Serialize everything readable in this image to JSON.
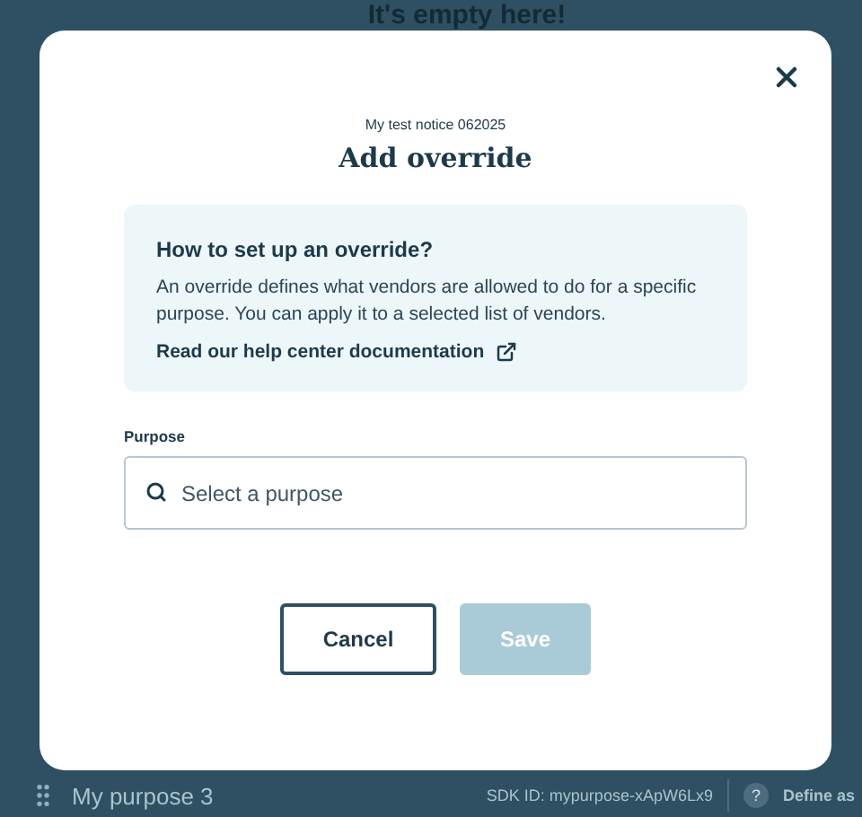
{
  "background": {
    "heading": "It's empty here!",
    "last_row": {
      "name": "My purpose 3",
      "sdk_id": "SDK ID: mypurpose-xApW6Lx9",
      "help": "?",
      "action": "Define as"
    }
  },
  "modal": {
    "subtitle": "My test notice 062025",
    "title": "Add override",
    "info": {
      "heading": "How to set up an override?",
      "text": "An override defines what vendors are allowed to do for a specific purpose. You can apply it to a selected list of vendors.",
      "link": "Read our help center documentation"
    },
    "field": {
      "label": "Purpose",
      "placeholder": "Select a purpose"
    },
    "buttons": [
      {
        "label": "Cancel",
        "kind": "secondary",
        "disabled": false
      },
      {
        "label": "Save",
        "kind": "primary",
        "disabled": true
      }
    ]
  }
}
